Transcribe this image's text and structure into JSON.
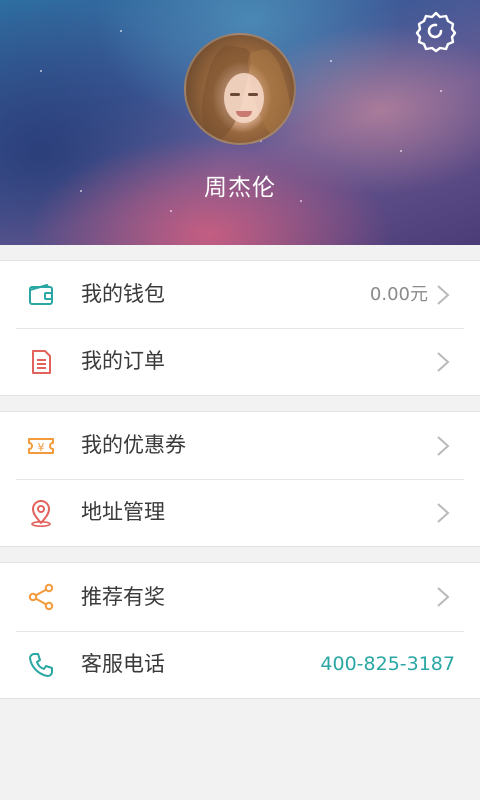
{
  "profile": {
    "name": "周杰伦"
  },
  "icons": {
    "settings": "gear-icon",
    "wallet": "wallet-icon",
    "orders": "document-icon",
    "coupons": "coupon-icon",
    "address": "location-pin-icon",
    "share": "share-icon",
    "phone": "phone-icon",
    "chevron": "chevron-right-icon"
  },
  "colors": {
    "teal": "#2aa7a3",
    "red": "#e2625c",
    "orange": "#f29a3c"
  },
  "menu": {
    "wallet": {
      "label": "我的钱包",
      "value": "0.00元"
    },
    "orders": {
      "label": "我的订单"
    },
    "coupons": {
      "label": "我的优惠券"
    },
    "address": {
      "label": "地址管理"
    },
    "referral": {
      "label": "推荐有奖"
    },
    "service": {
      "label": "客服电话",
      "value": "400-825-3187"
    }
  }
}
